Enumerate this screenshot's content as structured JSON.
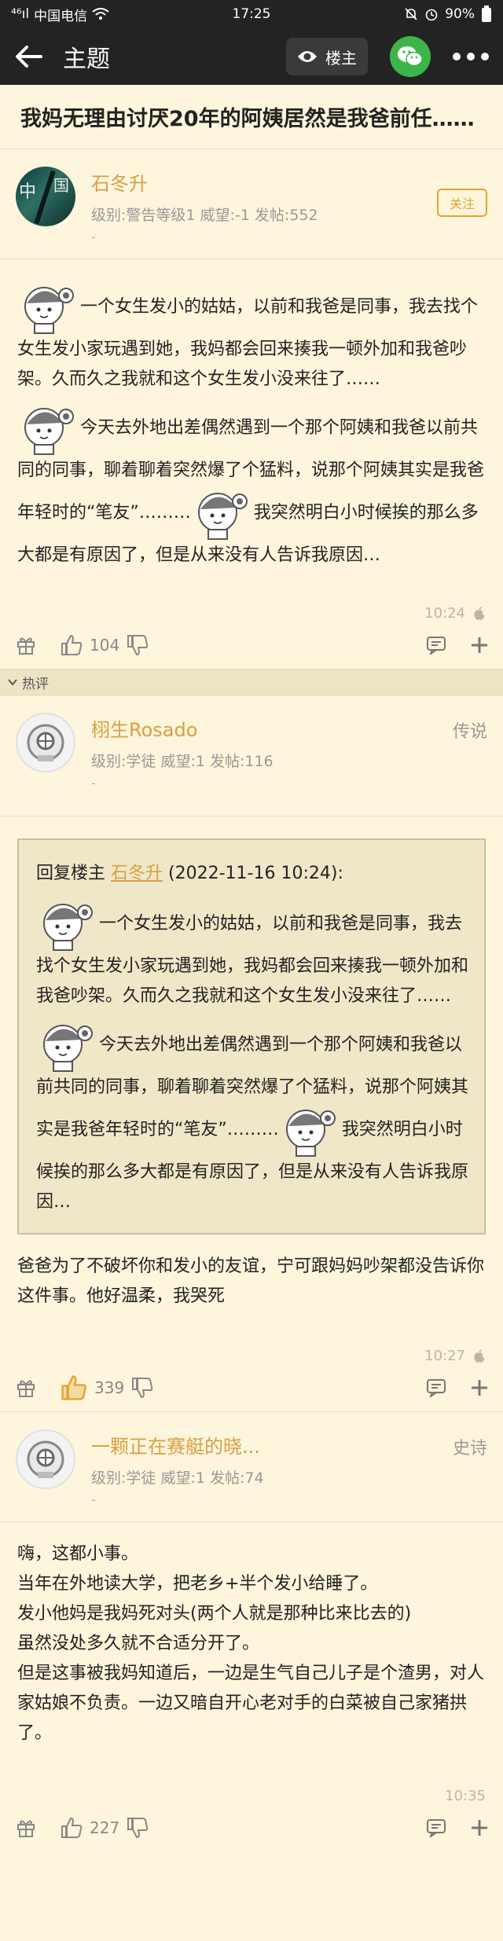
{
  "status_bar": {
    "signal": "⁴⁶ıl",
    "carrier": "中国电信",
    "time": "17:25",
    "battery": "90%"
  },
  "app_bar": {
    "title": "主题",
    "louzhu_label": "楼主"
  },
  "thread": {
    "title": "我妈无理由讨厌20年的阿姨居然是我爸前任……"
  },
  "posts": [
    {
      "username": "石冬升",
      "meta": "级别:警告等级1 威望:-1 发帖:552",
      "dash": "-",
      "follow_label": "关注",
      "para1": "一个女生发小的姑姑，以前和我爸是同事，我去找个女生发小家玩遇到她，我妈都会回来揍我一顿外加和我爸吵架。久而久之我就和这个女生发小没来往了……",
      "para2a": "今天去外地出差偶然遇到一个那个阿姨和我爸以前共同的同事，聊着聊着突然爆了个猛料，说那个阿姨其实是我爸年轻时的“笔友”………",
      "para2b": "我突然明白小时候挨的那么多大都是有原因了，但是从来没有人告诉我原因…",
      "time": "10:24",
      "likes": "104"
    },
    {
      "username": "栩生Rosado",
      "meta": "级别:学徒 威望:1 发帖:116",
      "dash": "-",
      "floor": "传说",
      "quote_prefix": "回复楼主",
      "quote_name": "石冬升",
      "quote_date": "(2022-11-16 10:24):",
      "quote_para1": "一个女生发小的姑姑，以前和我爸是同事，我去找个女生发小家玩遇到她，我妈都会回来揍我一顿外加和我爸吵架。久而久之我就和这个女生发小没来往了……",
      "quote_para2a": "今天去外地出差偶然遇到一个那个阿姨和我爸以前共同的同事，聊着聊着突然爆了个猛料，说那个阿姨其实是我爸年轻时的“笔友”………",
      "quote_para2b": "我突然明白小时候挨的那么多大都是有原因了，但是从来没有人告诉我原因…",
      "reply": "爸爸为了不破坏你和发小的友谊，宁可跟妈妈吵架都没告诉你这件事。他好温柔，我哭死",
      "time": "10:27",
      "likes": "339"
    },
    {
      "username": "一颗正在赛艇的晓...",
      "meta": "级别:学徒 威望:1 发帖:74",
      "dash": "-",
      "floor": "史诗",
      "lines": [
        "嗨，这都小事。",
        "当年在外地读大学，把老乡+半个发小给睡了。",
        "发小他妈是我妈死对头(两个人就是那种比来比去的)",
        "虽然没处多久就不合适分开了。",
        "但是这事被我妈知道后，一边是生气自己儿子是个渣男，对人家姑娘不负责。一边又暗自开心老对手的白菜被自己家猪拱了。"
      ],
      "time": "10:35",
      "likes": "227"
    }
  ],
  "hot_section": {
    "label": "热评"
  }
}
